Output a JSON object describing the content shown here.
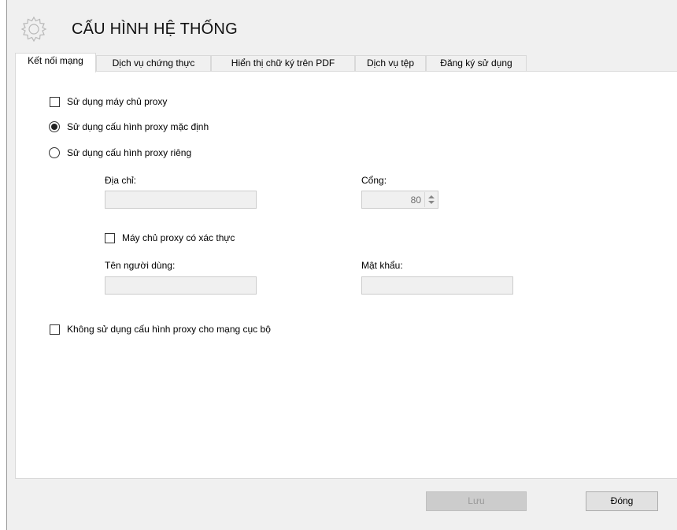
{
  "window": {
    "title": "CẤU HÌNH HỆ THỐNG"
  },
  "tabs": [
    {
      "label": "Kết nối mạng",
      "active": true
    },
    {
      "label": "Dịch vụ chứng thực",
      "active": false
    },
    {
      "label": "Hiển thị chữ ký trên PDF",
      "active": false
    },
    {
      "label": "Dịch vụ tệp",
      "active": false
    },
    {
      "label": "Đăng ký sử dụng",
      "active": false
    }
  ],
  "network": {
    "use_proxy": {
      "label": "Sử dụng máy chủ proxy",
      "checked": false
    },
    "default_proxy": {
      "label": "Sử dụng cấu hình proxy mặc định",
      "selected": true
    },
    "custom_proxy": {
      "label": "Sử dụng cấu hình proxy riêng",
      "selected": false
    },
    "address": {
      "label": "Địa chỉ:",
      "value": ""
    },
    "port": {
      "label": "Cổng:",
      "value": "80"
    },
    "auth": {
      "label": "Máy chủ proxy có xác thực",
      "checked": false
    },
    "username": {
      "label": "Tên người dùng:",
      "value": ""
    },
    "password": {
      "label": "Mật khẩu:",
      "value": ""
    },
    "bypass_local": {
      "label": "Không sử dụng cấu hình proxy cho mạng cục bộ",
      "checked": false
    }
  },
  "footer": {
    "save_label": "Lưu",
    "close_label": "Đóng"
  },
  "icons": {
    "header": "gear-icon"
  }
}
